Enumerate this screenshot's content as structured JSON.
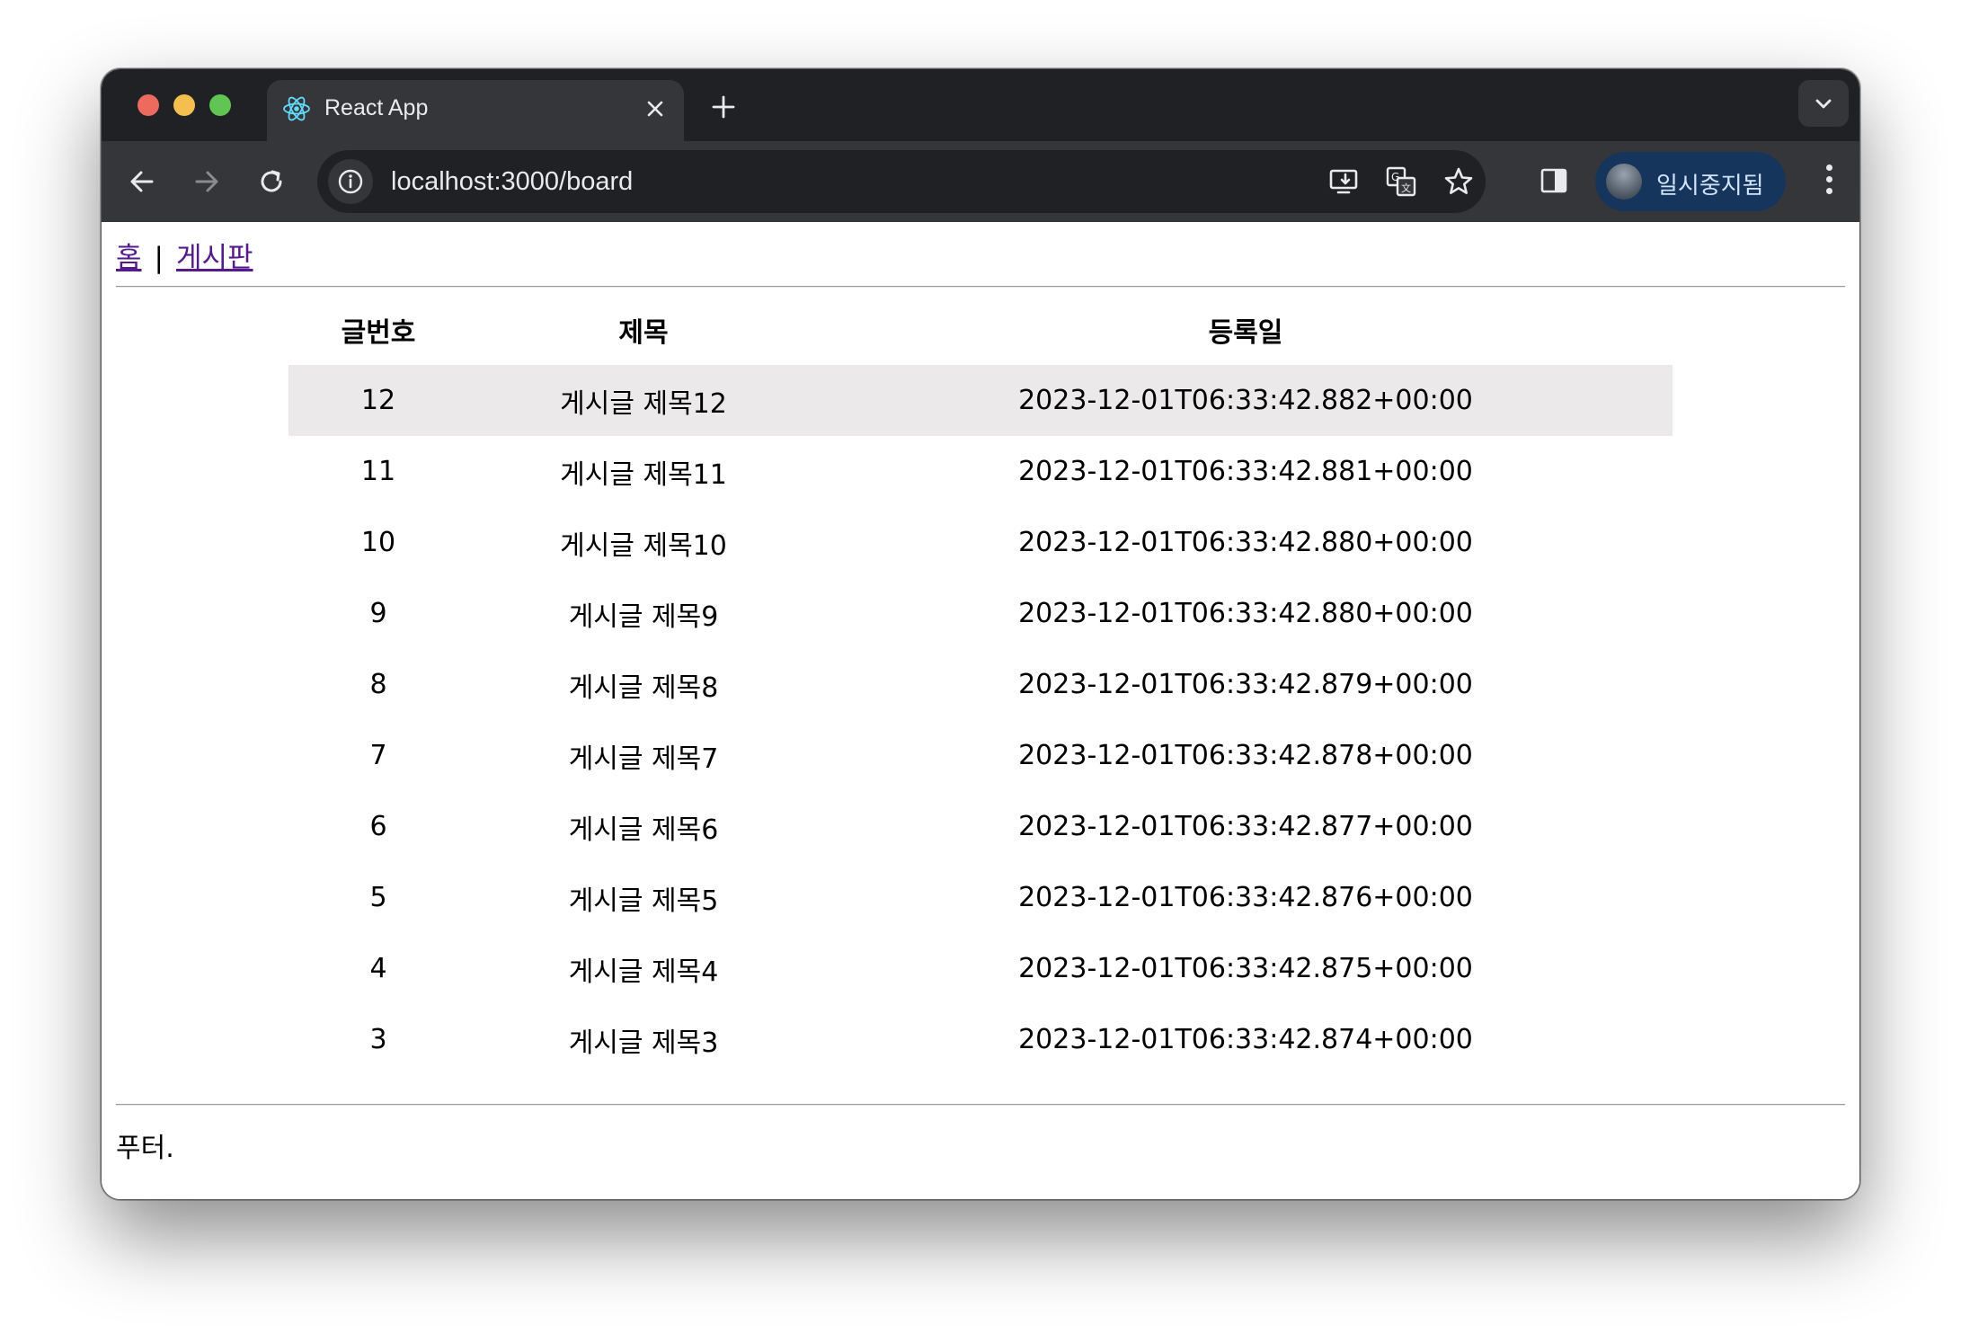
{
  "browser": {
    "tab_title": "React App",
    "tab_icon": "react-logo-icon",
    "url": "localhost:3000/board",
    "profile_label": "일시중지됨"
  },
  "nav": {
    "home_label": "홈",
    "separator": "|",
    "board_label": "게시판"
  },
  "table": {
    "headers": [
      "글번호",
      "제목",
      "등록일"
    ],
    "rows": [
      {
        "id": "12",
        "title": "게시글 제목12",
        "date": "2023-12-01T06:33:42.882+00:00"
      },
      {
        "id": "11",
        "title": "게시글 제목11",
        "date": "2023-12-01T06:33:42.881+00:00"
      },
      {
        "id": "10",
        "title": "게시글 제목10",
        "date": "2023-12-01T06:33:42.880+00:00"
      },
      {
        "id": "9",
        "title": "게시글 제목9",
        "date": "2023-12-01T06:33:42.880+00:00"
      },
      {
        "id": "8",
        "title": "게시글 제목8",
        "date": "2023-12-01T06:33:42.879+00:00"
      },
      {
        "id": "7",
        "title": "게시글 제목7",
        "date": "2023-12-01T06:33:42.878+00:00"
      },
      {
        "id": "6",
        "title": "게시글 제목6",
        "date": "2023-12-01T06:33:42.877+00:00"
      },
      {
        "id": "5",
        "title": "게시글 제목5",
        "date": "2023-12-01T06:33:42.876+00:00"
      },
      {
        "id": "4",
        "title": "게시글 제목4",
        "date": "2023-12-01T06:33:42.875+00:00"
      },
      {
        "id": "3",
        "title": "게시글 제목3",
        "date": "2023-12-01T06:33:42.874+00:00"
      }
    ]
  },
  "footer": {
    "text": "푸터."
  },
  "colors": {
    "link": "#551a8b",
    "highlight_row": "#ebe9ea",
    "chrome_dark": "#202124",
    "chrome_toolbar": "#35363a",
    "profile_bg": "#16355d"
  }
}
